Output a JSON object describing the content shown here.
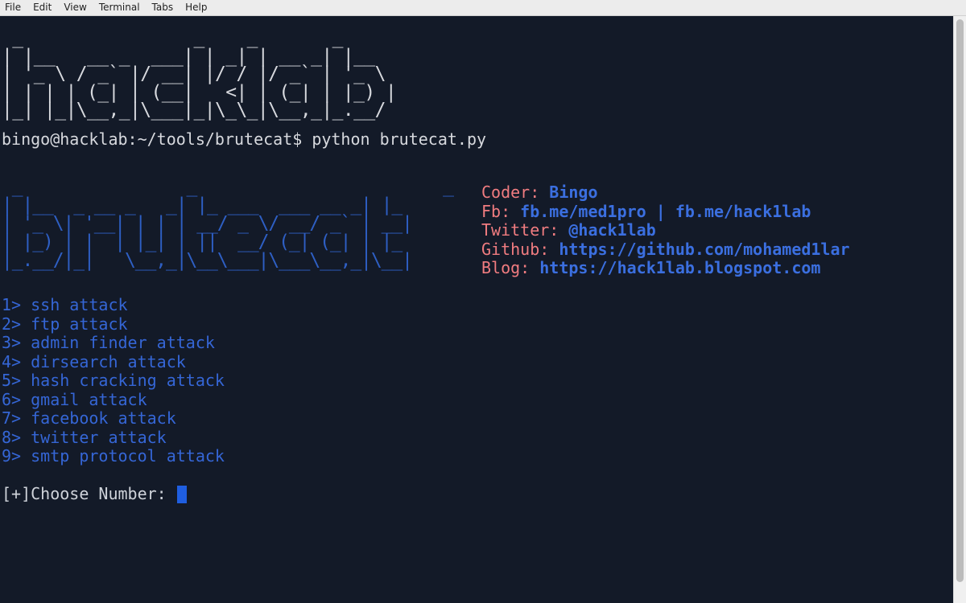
{
  "menubar": {
    "items": [
      "File",
      "Edit",
      "View",
      "Terminal",
      "Tabs",
      "Help"
    ]
  },
  "banner_hacklab": " _                _    _       _     \n| |__   __ _  ___| | _| | __ _| |__  \n| '_ \\ / _` |/ __| |/ / |/ _` | '_ \\ \n| | | | (_| | (__|   <| | (_| | |_) |\n|_| |_|\\__,_|\\___|_|\\_\\_|\\__,_|_.__/ ",
  "prompt": {
    "text": "bingo@hacklab:~/tools/brutecat$ python brutecat.py"
  },
  "banner_brutecat": " _                _                        _   \n| |__  _ __ _   _| |_ ___  ___ __ _| |_ \n| '_ \\| '__| | | | __/ _ \\/ __/ _` | __|\n| |_) | |  | |_| | ||  __/ (_| (_| | |_ \n|_.__/|_|   \\__,_|\\__\\___|\\___\\__,_|\\__|",
  "info": [
    {
      "key": "Coder: ",
      "value": "Bingo"
    },
    {
      "key": "Fb: ",
      "value": "fb.me/med1pro | fb.me/hack1lab"
    },
    {
      "key": "Twitter: ",
      "value": "@hack1lab"
    },
    {
      "key": "Github: ",
      "value": "https://github.com/mohamed1lar"
    },
    {
      "key": "Blog: ",
      "value": "https://hack1lab.blogspot.com"
    }
  ],
  "attack_menu": [
    "1> ssh attack",
    "2> ftp attack",
    "3> admin finder attack",
    "4> dirsearch attack",
    "5> hash cracking attack",
    "6> gmail attack",
    "7> facebook attack",
    "8> twitter attack",
    "9> smtp protocol attack"
  ],
  "input_prompt": "[+]Choose Number: ",
  "colors": {
    "background": "#131a28",
    "banner_blue": "#2e5fc4",
    "info_key": "#f07c80",
    "info_value": "#3b6fe0",
    "cursor": "#1f5ee0"
  }
}
